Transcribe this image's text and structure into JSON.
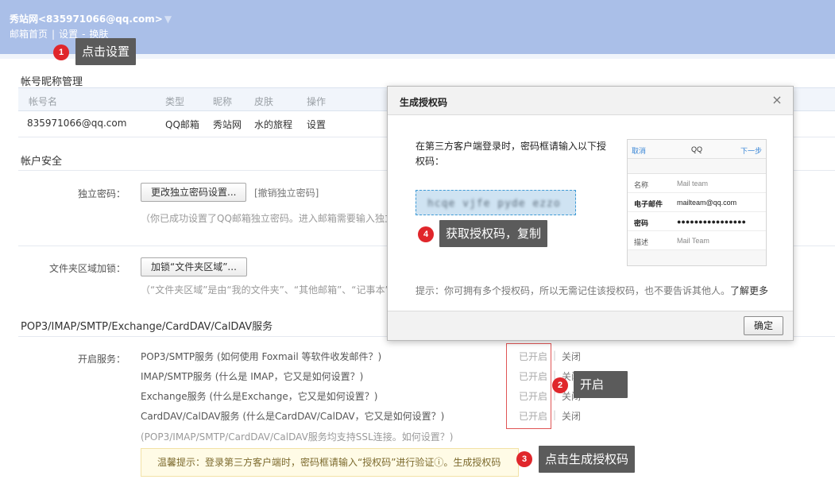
{
  "header": {
    "account": "秀站网<835971066@qq.com>",
    "caret": "▼",
    "links": [
      "邮箱首页",
      "设置",
      "换肤"
    ],
    "sep1": "|",
    "sep2": "-"
  },
  "callouts": {
    "c1": {
      "num": "1",
      "text": "点击设置"
    },
    "c2": {
      "num": "2",
      "text": "开启"
    },
    "c3": {
      "num": "3",
      "text": "点击生成授权码"
    },
    "c4": {
      "num": "4",
      "text": "获取授权码，复制"
    }
  },
  "nickname_section": {
    "title": "帐号昵称管理",
    "columns": [
      "帐号名",
      "类型",
      "昵称",
      "皮肤",
      "操作"
    ],
    "row": [
      "835971066@qq.com",
      "QQ邮箱",
      "秀站网",
      "水的旅程",
      "设置"
    ]
  },
  "security_section": {
    "title": "帐户安全",
    "pwd_label": "独立密码：",
    "pwd_button": "更改独立密码设置...",
    "pwd_revoke": "[撤销独立密码]",
    "pwd_hint": "（你已成功设置了QQ邮箱独立密码。进入邮箱需要输入独立",
    "folder_label": "文件夹区域加锁：",
    "folder_button": "加锁“文件夹区域”...",
    "folder_hint": "（“文件夹区域”是由“我的文件夹”、“其他邮箱”、“记事本”结"
  },
  "pop_section": {
    "title": "POP3/IMAP/SMTP/Exchange/CardDAV/CalDAV服务",
    "label": "开启服务：",
    "services": [
      {
        "name": "POP3/SMTP服务 (如何使用 Foxmail 等软件收发邮件？)",
        "on": "已开启",
        "off": "关闭"
      },
      {
        "name": "IMAP/SMTP服务 (什么是 IMAP，它又是如何设置？)",
        "on": "已开启",
        "off": "关闭"
      },
      {
        "name": "Exchange服务 (什么是Exchange，它又是如何设置？)",
        "on": "已开启",
        "off": "关闭"
      },
      {
        "name": "CardDAV/CalDAV服务 (什么是CardDAV/CalDAV，它又是如何设置？)",
        "on": "已开启",
        "off": "关闭"
      }
    ],
    "bar": "|",
    "ssl_hint": "(POP3/IMAP/SMTP/CardDAV/CalDAV服务均支持SSL连接。如何设置？)",
    "notice": "温馨提示：登录第三方客户端时，密码框请输入“授权码”进行验证ⓘ。生成授权码"
  },
  "modal": {
    "title": "生成授权码",
    "close": "×",
    "text": "在第三方客户端登录时，密码框请输入以下授权码：",
    "code": "hcqe vjfe pyde ezzo",
    "hint": "提示：你可拥有多个授权码，所以无需记住该授权码，也不要告诉其他人。",
    "more": "了解更多",
    "ok": "确定",
    "phone": {
      "cancel": "取消",
      "qq": "QQ",
      "next": "下一步",
      "rows": [
        {
          "k": "名称",
          "v": "Mail team"
        },
        {
          "k": "电子邮件",
          "v": "mailteam@qq.com"
        },
        {
          "k": "密码",
          "v": "●●●●●●●●●●●●●●●●"
        },
        {
          "k": "描述",
          "v": "Mail Team"
        }
      ]
    }
  }
}
